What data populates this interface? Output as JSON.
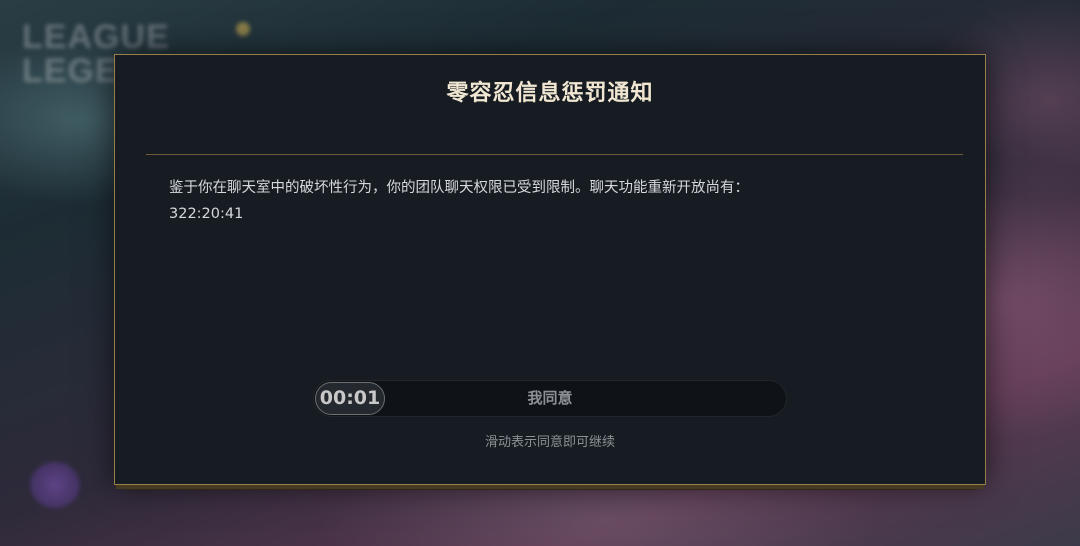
{
  "background": {
    "logo_text": "LEAGUE of LEGENDS"
  },
  "dialog": {
    "title": "零容忍信息惩罚通知",
    "message": "鉴于你在聊天室中的破坏性行为，你的团队聊天权限已受到限制。聊天功能重新开放尚有：",
    "time_remaining": "322:20:41",
    "slider": {
      "timer": "00:01",
      "label": "我同意"
    },
    "hint": "滑动表示同意即可继续"
  },
  "colors": {
    "dialog_bg": "#161c22",
    "gold_border": "#9a7e48",
    "title_text": "#f0e6d2"
  }
}
